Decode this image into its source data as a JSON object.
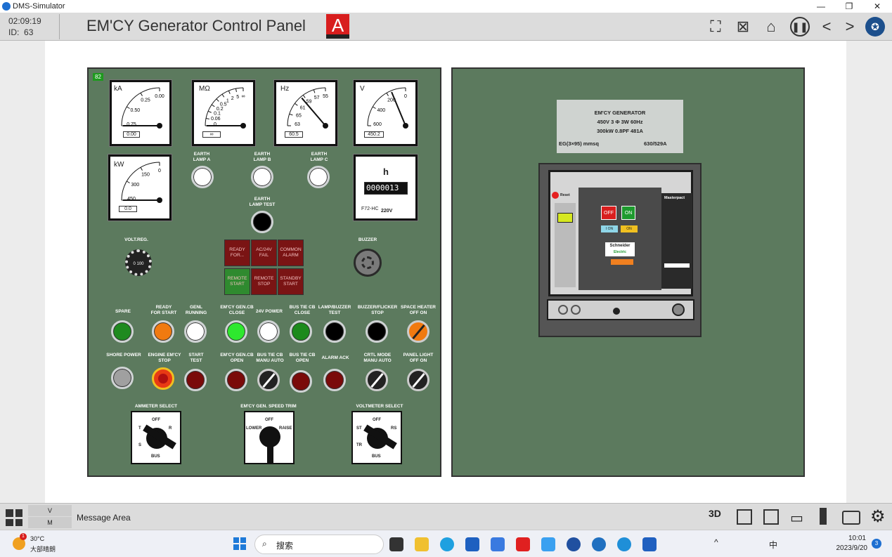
{
  "window": {
    "title": "DMS-Simulator",
    "minimize": "—",
    "restore": "❐",
    "close": "✕"
  },
  "header": {
    "time": "02:09:19",
    "id_label": "ID:",
    "id_value": "63",
    "title": "EM'CY Generator Control Panel",
    "alarm_letter": "A",
    "icons": [
      "fullscreen-icon",
      "mute-icon",
      "home-icon",
      "pause-icon",
      "previous-icon",
      "next-icon",
      "emblem-icon"
    ],
    "prev": "<",
    "next": ">"
  },
  "panel": {
    "badge": "82",
    "meters": {
      "kA": {
        "unit": "kA",
        "ticks": [
          "0.75",
          "0.50",
          "0.25",
          "0.00"
        ],
        "readout": "0.00",
        "value_fraction": 0.0
      },
      "mohm": {
        "unit": "MΩ",
        "ticks": [
          "0",
          "0.06",
          "0.1",
          "0.2",
          "0.5",
          "1",
          "2",
          "5",
          "∞"
        ],
        "readout": "∞",
        "value_fraction": 0.0
      },
      "hz": {
        "unit": "Hz",
        "ticks": [
          "63",
          "65",
          "61",
          "59",
          "57",
          "55"
        ],
        "readout": "60.5",
        "value_fraction": 0.55
      },
      "v": {
        "unit": "V",
        "ticks": [
          "600",
          "400",
          "200",
          "0"
        ],
        "readout": "450.2",
        "value_fraction": 0.75
      },
      "kw": {
        "unit": "kW",
        "ticks": [
          "450",
          "300",
          "150",
          "0"
        ],
        "readout": "0.0",
        "value_fraction": 0.0
      },
      "hour": {
        "unit": "h",
        "counter": "0000013",
        "model": "F72-HC",
        "voltage": "220V"
      }
    },
    "labels": {
      "earth_a": "EARTH\nLAMP A",
      "earth_b": "EARTH\nLAMP B",
      "earth_c": "EARTH\nLAMP C",
      "earth_test": "EARTH\nLAMP TEST",
      "volt_reg": "VOLT.REG.",
      "volt_reg_scale": "0 100",
      "buzzer": "BUZZER",
      "spare": "SPARE",
      "ready": "READY\nFOR START",
      "genl_running": "GENL\nRUNNING",
      "gen_cb_close": "EM'CY GEN.CB\nCLOSE",
      "pwr24": "24V POWER",
      "bustie_close": "BUS TIE CB\nCLOSE",
      "lamp_buzzer": "LAMP/BUZZER\nTEST",
      "buzzer_flicker": "BUZZER/FLICKER\nSTOP",
      "space_heater": "SPACE HEATER\nOFF    ON",
      "shore": "SHORE POWER",
      "engine_stop": "ENGINE EM'CY\nSTOP",
      "start_test": "START\nTEST",
      "gen_cb_open": "EM'CY GEN.CB\nOPEN",
      "bustie_mode": "BUS TIE CB\nMANU    AUTO",
      "bustie_open": "BUS TIE CB\nOPEN",
      "alarm_ack": "ALARM ACK",
      "ctrl_mode": "CRTL MODE\nMANU    AUTO",
      "panel_light": "PANEL LIGHT\nOFF    ON",
      "ammeter_select": "AMMETER SELECT",
      "speed_trim": "EM'CY GEN. SPEED TRIM",
      "voltmeter_select": "VOLTMETER SELECT"
    },
    "annunciators": [
      {
        "text": "READY\nFOR...",
        "color": "#7a1414"
      },
      {
        "text": "AC/24V\nFAIL",
        "color": "#7a1414"
      },
      {
        "text": "COMMON\nALARM",
        "color": "#7a1414"
      },
      {
        "text": "REMOTE\nSTART",
        "color": "#2f8a2f"
      },
      {
        "text": "REMOTE\nSTOP",
        "color": "#7a1414"
      },
      {
        "text": "STANDBY\nSTART",
        "color": "#7a1414"
      }
    ],
    "ammeter_selector": {
      "off": "OFF",
      "t": "T",
      "r": "R",
      "s": "S",
      "bus": "BUS"
    },
    "speed_selector": {
      "off": "OFF",
      "lower": "LOWER",
      "raise": "RAISE"
    },
    "volt_selector": {
      "off": "OFF",
      "st": "ST",
      "rs": "RS",
      "tr": "TR",
      "bus": "BUS"
    }
  },
  "breaker": {
    "plate_line1": "EM'CY GENERATOR",
    "plate_line2": "450V 3 Φ 3W 60Hz",
    "plate_line3": "300kW 0.8PF 481A",
    "plate_cable": "EG(3×95)  mmsq",
    "plate_rating": "630/529A",
    "reset": "Reset",
    "off": "OFF",
    "on": "ON",
    "brand": "Schneider",
    "brand_sub": "Electric",
    "model": "Masterpact",
    "state_off": "I  ON",
    "state_on": "ON"
  },
  "bottom": {
    "v": "V",
    "m": "M",
    "message": "Message Area",
    "mode3d": "3D"
  },
  "taskbar": {
    "temp": "30°C",
    "weather": "大部晴朗",
    "search": "搜索",
    "time": "10:01",
    "date": "2023/9/20",
    "lang": "中",
    "notif": "3",
    "badge": "1"
  }
}
